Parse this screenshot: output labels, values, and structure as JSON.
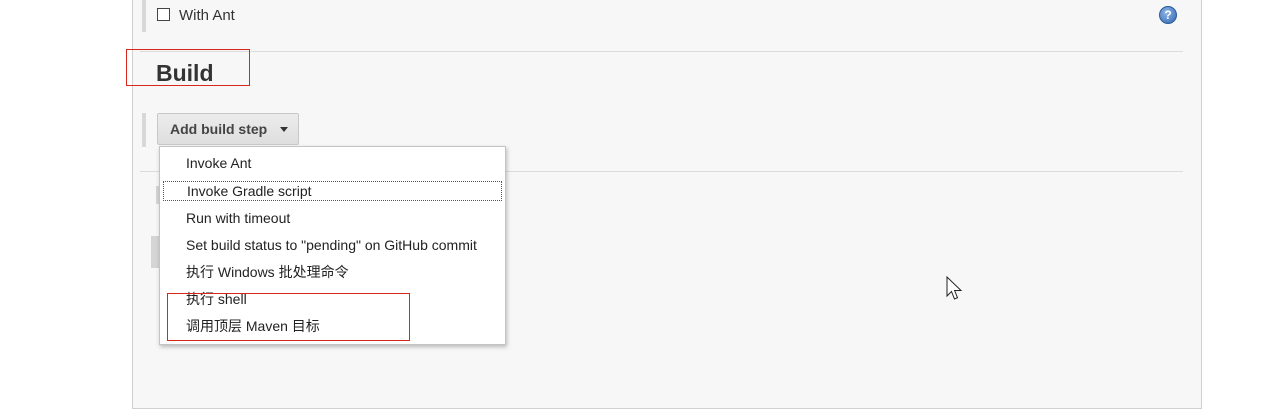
{
  "publishers_section": {
    "checkbox_label": "With Ant",
    "checkbox_checked": false,
    "help_icon": "question-circle-icon",
    "help_glyph": "?"
  },
  "build_section": {
    "title": "Build",
    "add_step_button_label": "Add build step",
    "add_step_button_icon": "caret-down-icon",
    "dropdown_items": [
      "Invoke Ant",
      "Invoke Gradle script",
      "Run with timeout",
      "Set build status to \"pending\" on GitHub commit",
      "执行 Windows 批处理命令",
      "执行 shell",
      "调用顶层 Maven 目标"
    ],
    "focused_item": "Invoke Gradle script"
  },
  "annotations": {
    "highlight_color": "#d9261c"
  },
  "cursor_icon": "mouse-pointer-icon"
}
